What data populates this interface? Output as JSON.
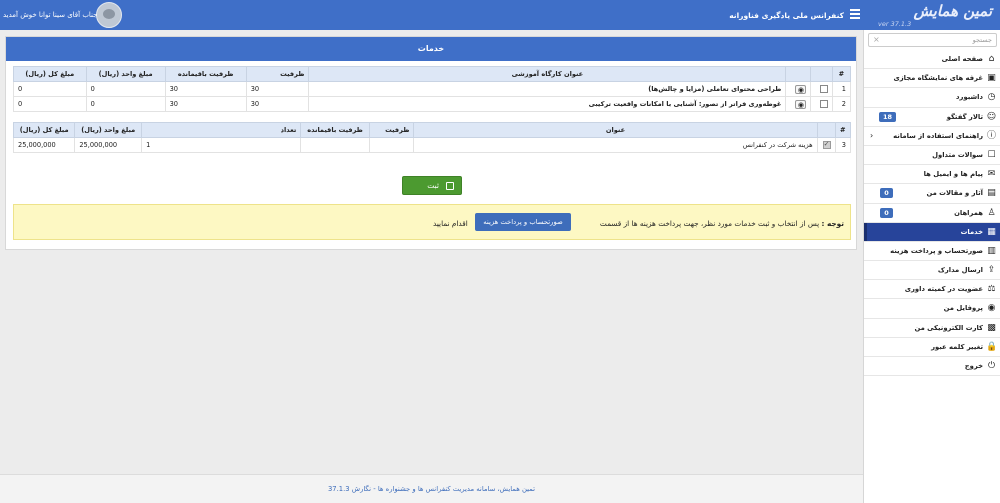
{
  "header": {
    "logo_text": "تمین همایش",
    "version": "ver 37.1.3",
    "conference_title": "کنفرانس ملی یادگیری فناورانه",
    "welcome": "جناب آقای سینا توانا خوش آمدید"
  },
  "sidebar": {
    "search_placeholder": "جستجو",
    "items": [
      {
        "label": "صفحه اصلی",
        "icon": "home-icon",
        "glyph": "⌂"
      },
      {
        "label": "غرفه های نمایشگاه مجازی",
        "icon": "exhibition-icon",
        "glyph": "▣"
      },
      {
        "label": "داشبورد",
        "icon": "dashboard-icon",
        "glyph": "◷"
      },
      {
        "label": "تالار گفتگو",
        "icon": "user-icon",
        "glyph": "☺",
        "badge": "18"
      },
      {
        "label": "راهنمای استفاده از سامانه",
        "icon": "info-icon",
        "glyph": "ⓘ",
        "chevron": "›"
      },
      {
        "label": "سوالات متداول",
        "icon": "chat-icon",
        "glyph": "☐"
      },
      {
        "label": "پیام ها و ایمیل ها",
        "icon": "message-icon",
        "glyph": "✉"
      },
      {
        "label": "آثار و مقالات من",
        "icon": "document-icon",
        "glyph": "▤",
        "badge": "0"
      },
      {
        "label": "همراهان",
        "icon": "companions-icon",
        "glyph": "♙",
        "badge": "0"
      },
      {
        "label": "خدمات",
        "icon": "services-icon",
        "glyph": "▦",
        "active": true
      },
      {
        "label": "صورتحساب و پرداخت هزینه",
        "icon": "invoice-icon",
        "glyph": "▥"
      },
      {
        "label": "ارسال مدارک",
        "icon": "upload-icon",
        "glyph": "⇪"
      },
      {
        "label": "عضویت در کمیته داوری",
        "icon": "committee-icon",
        "glyph": "⚖"
      },
      {
        "label": "پروفایل من",
        "icon": "profile-icon",
        "glyph": "◉"
      },
      {
        "label": "کارت الکترونیکی من",
        "icon": "card-icon",
        "glyph": "▩"
      },
      {
        "label": "تغییر کلمه عبور",
        "icon": "lock-icon",
        "glyph": "🔒"
      },
      {
        "label": "خروج",
        "icon": "logout-icon",
        "glyph": "⏻"
      }
    ]
  },
  "main": {
    "title": "خدمات",
    "workshops_table": {
      "headers": {
        "index": "#",
        "title": "عنوان کارگاه آموزشی",
        "capacity": "ظرفیت",
        "remaining": "ظرفیت باقیمانده",
        "unit_price": "مبلغ واحد (ریال)",
        "total": "مبلغ کل (ریال)"
      },
      "rows": [
        {
          "index": "1",
          "title": "طراحی محتوای تعاملی (مزایا و چالش‌ها)",
          "capacity": "30",
          "remaining": "30",
          "unit_price": "0",
          "total": "0"
        },
        {
          "index": "2",
          "title": "غوطه‌وری فراتر از تصور: آشنایی با امکانات واقعیت ترکیبی",
          "capacity": "30",
          "remaining": "30",
          "unit_price": "0",
          "total": "0"
        }
      ]
    },
    "fees_table": {
      "headers": {
        "index": "#",
        "title": "عنوان",
        "capacity": "ظرفیت",
        "remaining": "ظرفیت باقیمانده",
        "count": "تعداد",
        "unit_price": "مبلغ واحد (ریال)",
        "total": "مبلغ کل (ریال)"
      },
      "rows": [
        {
          "index": "3",
          "title": "هزینه شرکت در کنفرانس",
          "capacity": "",
          "remaining": "",
          "count": "1",
          "unit_price": "25,000,000",
          "total": "25,000,000"
        }
      ]
    },
    "submit_label": "ثبت",
    "notice": {
      "bold": "توجه :",
      "text_before": "پس از انتخاب و ثبت خدمات مورد نظر، جهت پرداخت هزینه ها از قسمت",
      "button": "صورتحساب و پرداخت هزینه",
      "text_after": "اقدام نمایید"
    }
  },
  "footer": {
    "text": "تمین همایش، سامانه مدیریت کنفرانس ها و جشنواره ها - نگارش 37.1.3"
  },
  "colors": {
    "primary": "#3f6fc8",
    "active": "#27449a",
    "success": "#4c9a30",
    "notice": "#fdf8c3"
  }
}
